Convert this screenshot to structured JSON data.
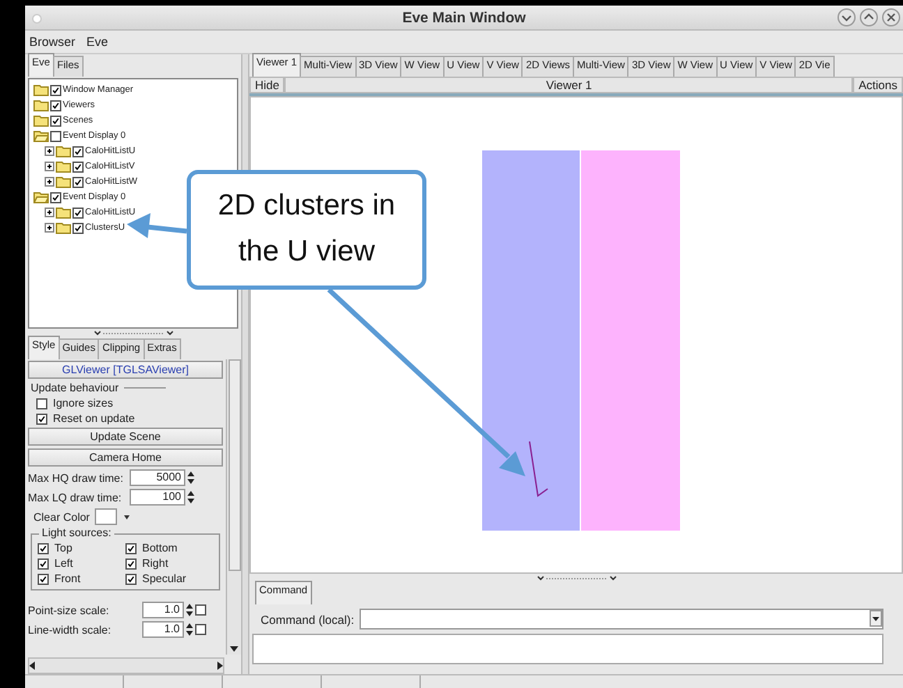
{
  "window": {
    "title": "Eve Main Window"
  },
  "menu": [
    "Browser",
    "Eve"
  ],
  "browser_tabs": [
    {
      "label": "Eve",
      "selected": true
    },
    {
      "label": "Files",
      "selected": false
    }
  ],
  "tree": [
    {
      "label": "Window Manager",
      "checked": true
    },
    {
      "label": "Viewers",
      "checked": true
    },
    {
      "label": "Scenes",
      "checked": true
    },
    {
      "label": "Event Display 0",
      "checked": false,
      "expanded": true,
      "children": [
        {
          "label": "CaloHitListU",
          "checked": true,
          "expanded": false
        },
        {
          "label": "CaloHitListV",
          "checked": true,
          "expanded": false
        },
        {
          "label": "CaloHitListW",
          "checked": true,
          "expanded": false
        }
      ]
    },
    {
      "label": "Event Display 0",
      "checked": true,
      "expanded": true,
      "children": [
        {
          "label": "CaloHitListU",
          "checked": true,
          "expanded": false
        },
        {
          "label": "ClustersU",
          "checked": true,
          "expanded": false
        }
      ]
    }
  ],
  "editor_tabs": [
    {
      "label": "Style",
      "selected": true
    },
    {
      "label": "Guides",
      "selected": false
    },
    {
      "label": "Clipping",
      "selected": false
    },
    {
      "label": "Extras",
      "selected": false
    }
  ],
  "viewer_button": "GLViewer [TGLSAViewer]",
  "update_group": {
    "title": "Update behaviour",
    "options": [
      {
        "label": "Ignore sizes",
        "checked": false
      },
      {
        "label": "Reset on update",
        "checked": true
      }
    ]
  },
  "buttons": [
    "Update Scene",
    "Camera Home"
  ],
  "draw_times": [
    {
      "label": "Max HQ draw time:",
      "value": "5000"
    },
    {
      "label": "Max LQ draw time:",
      "value": "100"
    }
  ],
  "clear_color": {
    "label": "Clear Color",
    "color": "#ffffff"
  },
  "light_sources": {
    "title": "Light sources:",
    "items": [
      {
        "label": "Top",
        "checked": true
      },
      {
        "label": "Bottom",
        "checked": true
      },
      {
        "label": "Left",
        "checked": true
      },
      {
        "label": "Right",
        "checked": true
      },
      {
        "label": "Front",
        "checked": true
      },
      {
        "label": "Specular",
        "checked": true
      }
    ]
  },
  "scales": [
    {
      "label": "Point-size scale:",
      "value": "1.0",
      "checked": false
    },
    {
      "label": "Line-width scale:",
      "value": "1.0",
      "checked": false
    }
  ],
  "viewer_tabs": [
    {
      "label": "Viewer 1",
      "selected": true
    },
    {
      "label": "Multi-View",
      "selected": false
    },
    {
      "label": "3D View",
      "selected": false
    },
    {
      "label": "W View",
      "selected": false
    },
    {
      "label": "U View",
      "selected": false
    },
    {
      "label": "V View",
      "selected": false
    },
    {
      "label": "2D Views",
      "selected": false
    },
    {
      "label": "Multi-View",
      "selected": false
    },
    {
      "label": "3D View",
      "selected": false
    },
    {
      "label": "W View",
      "selected": false
    },
    {
      "label": "U View",
      "selected": false
    },
    {
      "label": "V View",
      "selected": false
    },
    {
      "label": "2D Vie",
      "selected": false
    }
  ],
  "viewer_header": {
    "hide": "Hide",
    "title": "Viewer 1",
    "actions": "Actions"
  },
  "command_tab": {
    "label": "Command",
    "selected": true
  },
  "command": {
    "label": "Command (local):"
  },
  "callout": {
    "text": "2D clusters in the U view"
  }
}
